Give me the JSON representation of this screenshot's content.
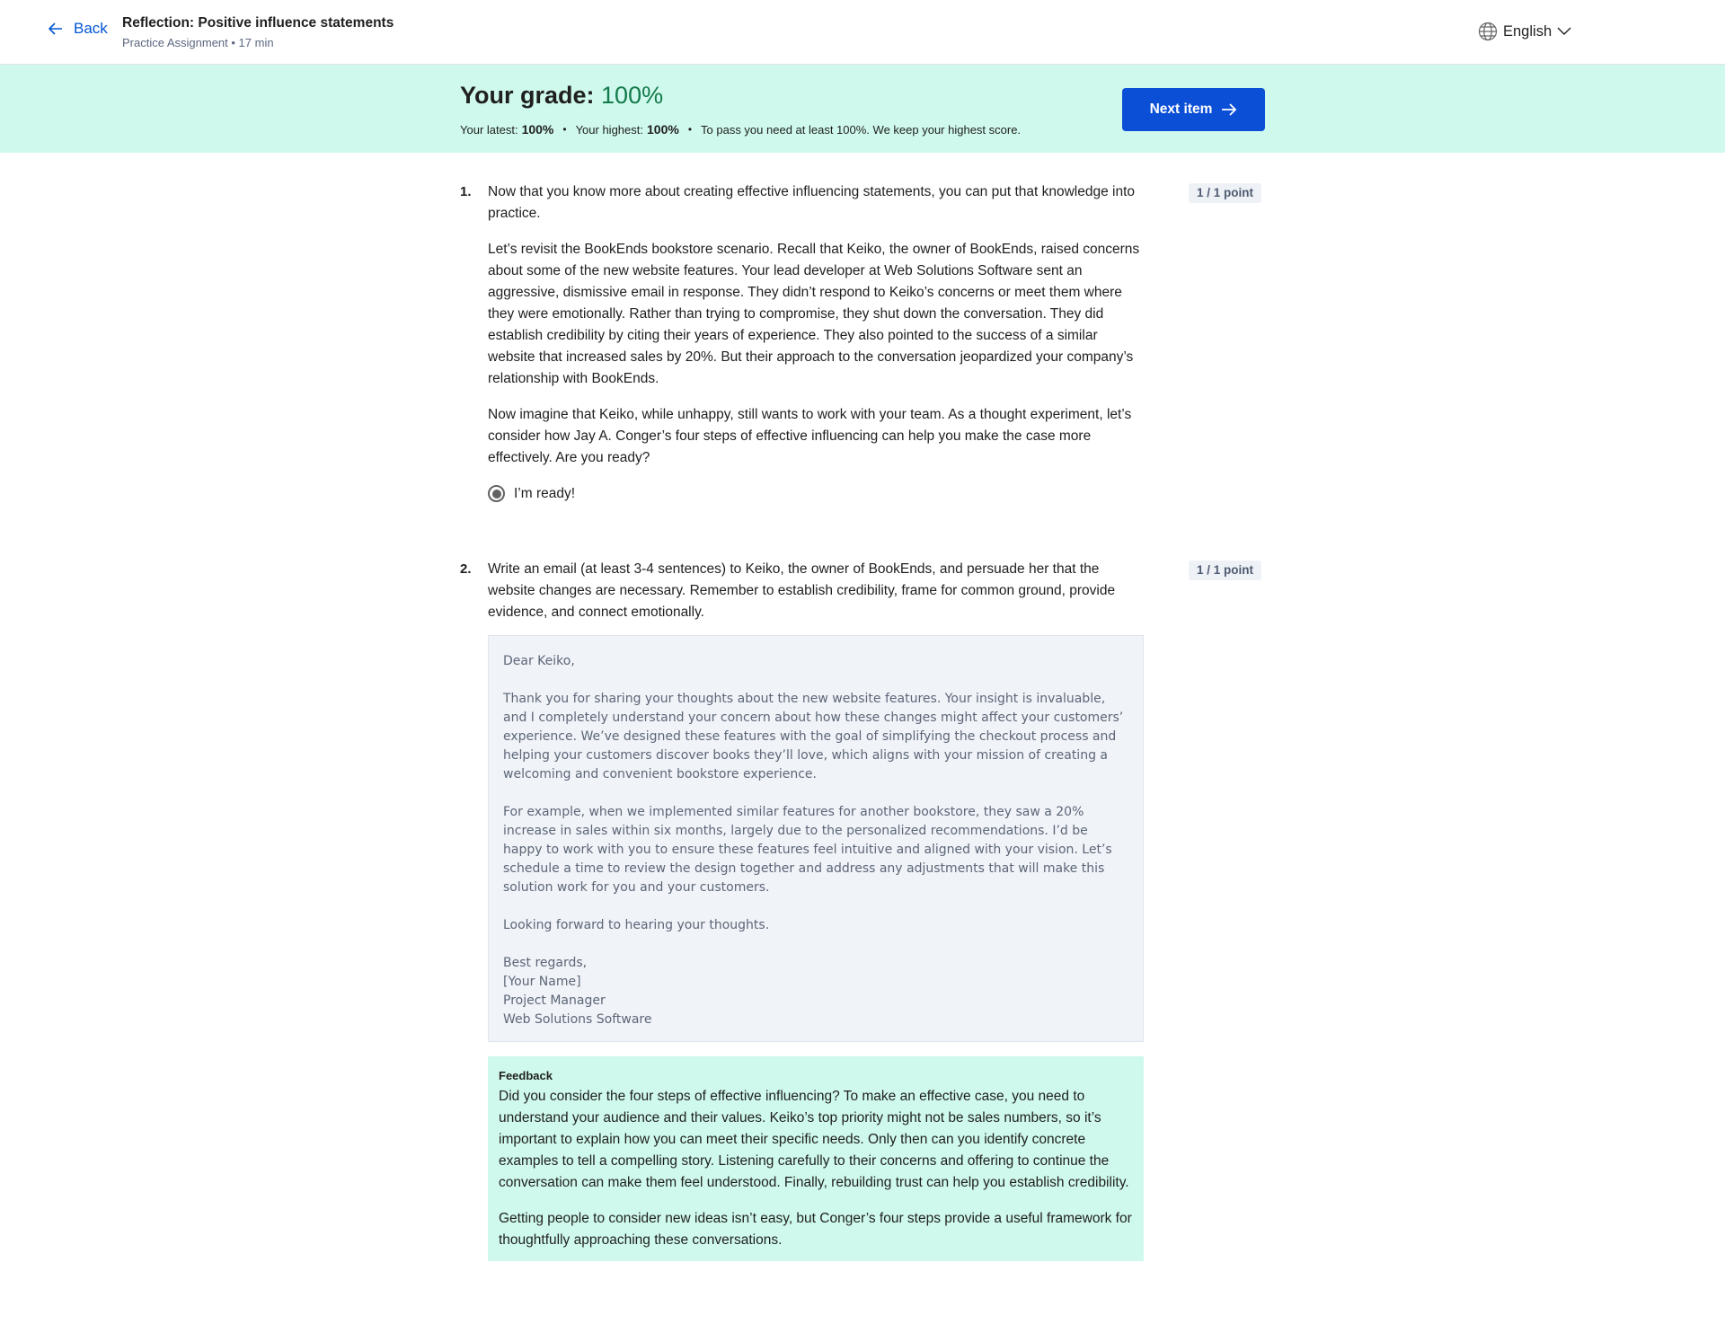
{
  "header": {
    "back_label": "Back",
    "title": "Reflection: Positive influence statements",
    "subtitle": "Practice Assignment • 17 min",
    "language": "English"
  },
  "grade": {
    "label": "Your grade:",
    "value": "100%",
    "latest_label": "Your latest:",
    "latest_value": "100%",
    "highest_label": "Your highest:",
    "highest_value": "100%",
    "pass_note": "To pass you need at least 100%. We keep your highest score.",
    "next_label": "Next item"
  },
  "questions": [
    {
      "number": "1.",
      "points": "1 / 1 point",
      "paragraphs": [
        "Now that you know more about creating effective influencing statements, you can put that knowledge into practice.",
        "Let’s revisit the BookEnds bookstore scenario. Recall that Keiko, the owner of BookEnds, raised concerns about some of the new website features. Your lead developer at Web Solutions Software sent an aggressive, dismissive email in response. They didn’t respond to Keiko’s concerns or meet them where they were emotionally. Rather than trying to compromise, they shut down the conversation. They did establish credibility by citing their years of experience. They also pointed to the success of a similar website that increased sales by 20%. But their approach to the conversation jeopardized your company’s relationship with BookEnds.",
        "Now imagine that Keiko, while unhappy, still wants to work with your team. As a thought experiment, let’s consider how Jay A. Conger’s four steps of effective influencing can help you make the case more effectively. Are you ready?"
      ],
      "option": "I’m ready!"
    },
    {
      "number": "2.",
      "points": "1 / 1 point",
      "prompt": "Write an email (at least 3-4 sentences) to Keiko, the owner of BookEnds, and persuade her that the website changes are necessary. Remember to establish credibility, frame for common ground, provide evidence, and connect emotionally.",
      "answer": {
        "greeting": "Dear Keiko,",
        "p1": "Thank you for sharing your thoughts about the new website features. Your insight is invaluable, and I completely understand your concern about how these changes might affect your customers’ experience. We’ve designed these features with the goal of simplifying the checkout process and helping your customers discover books they’ll love, which aligns with your mission of creating a welcoming and convenient bookstore experience.",
        "p2": "For example, when we implemented similar features for another bookstore, they saw a 20% increase in sales within six months, largely due to the personalized recommendations. I’d be happy to work with you to ensure these features feel intuitive and aligned with your vision. Let’s schedule a time to review the design together and address any adjustments that will make this solution work for you and your customers.",
        "p3": "Looking forward to hearing your thoughts.",
        "sign1": "Best regards,",
        "sign2": "[Your Name]",
        "sign3": "Project Manager",
        "sign4": "Web Solutions Software"
      },
      "feedback": {
        "heading": "Feedback",
        "p1": "Did you consider the four steps of effective influencing? To make an effective case, you need to understand your audience and their values. Keiko’s top priority might not be sales numbers, so it’s important to explain how you can meet their specific needs. Only then can you identify concrete examples to tell a compelling story. Listening carefully to their concerns and offering to continue the conversation can make them feel understood. Finally, rebuilding trust can help you establish credibility.",
        "p2": "Getting people to consider new ideas isn’t easy, but Conger’s four steps provide a useful framework for thoughtfully approaching these conversations."
      }
    }
  ],
  "colors": {
    "accent": "#0056d2",
    "button": "#0b4fd6",
    "banner": "#cff9ec",
    "grade_green": "#137a4b"
  }
}
